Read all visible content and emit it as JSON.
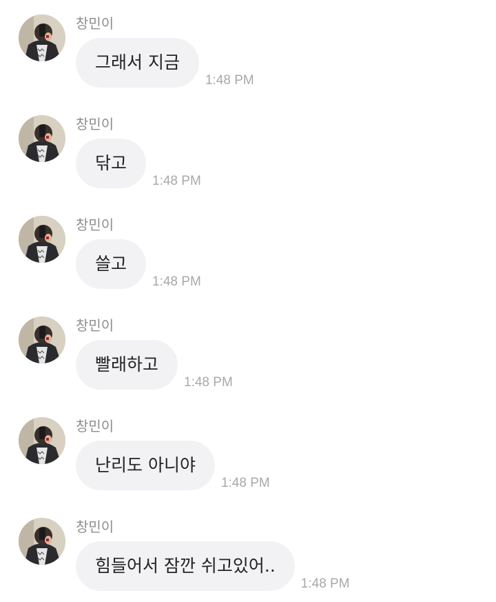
{
  "messages": [
    {
      "sender": "창민이",
      "text": "그래서 지금",
      "time": "1:48 PM",
      "avatar_icon": "profile-photo"
    },
    {
      "sender": "창민이",
      "text": "닦고",
      "time": "1:48 PM",
      "avatar_icon": "profile-photo"
    },
    {
      "sender": "창민이",
      "text": "쓸고",
      "time": "1:48 PM",
      "avatar_icon": "profile-photo"
    },
    {
      "sender": "창민이",
      "text": "빨래하고",
      "time": "1:48 PM",
      "avatar_icon": "profile-photo"
    },
    {
      "sender": "창민이",
      "text": "난리도 아니야",
      "time": "1:48 PM",
      "avatar_icon": "profile-photo"
    },
    {
      "sender": "창민이",
      "text": "힘들어서 잠깐 쉬고있어..",
      "time": "1:48 PM",
      "avatar_icon": "profile-photo"
    }
  ],
  "colors": {
    "bubble": "#f2f2f4",
    "sender": "#8d8d8d",
    "time": "#a8a8a8",
    "text": "#222222",
    "background": "#ffffff"
  }
}
